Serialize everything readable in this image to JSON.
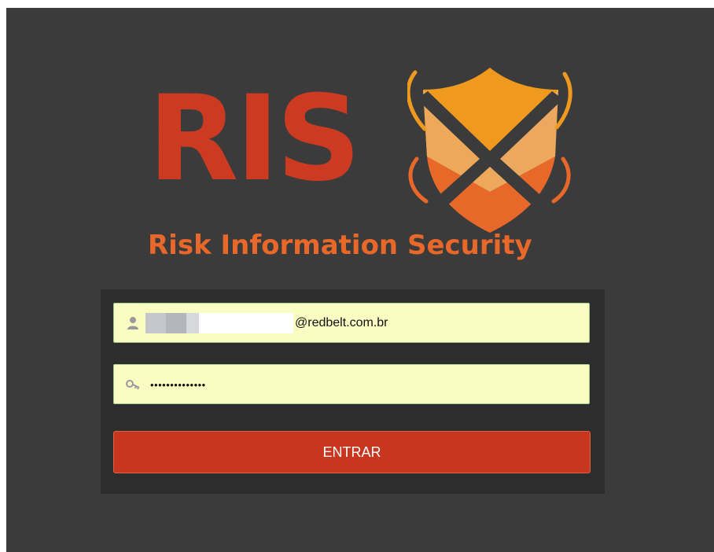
{
  "logo": {
    "wordmark": "RIS",
    "tagline": "Risk Information Security"
  },
  "login": {
    "email_value": "@redbelt.com.br",
    "password_value": "••••••••••••••",
    "submit_label": "ENTRAR"
  },
  "icons": {
    "email_field": "user-icon",
    "password_field": "key-icon"
  },
  "colors": {
    "page_background": "#3b3b3b",
    "panel_background": "#2d2d2d",
    "brand_red": "#cc3a22",
    "brand_orange": "#e8682a",
    "field_background": "#fafdc2",
    "button_background": "#c8361f"
  }
}
